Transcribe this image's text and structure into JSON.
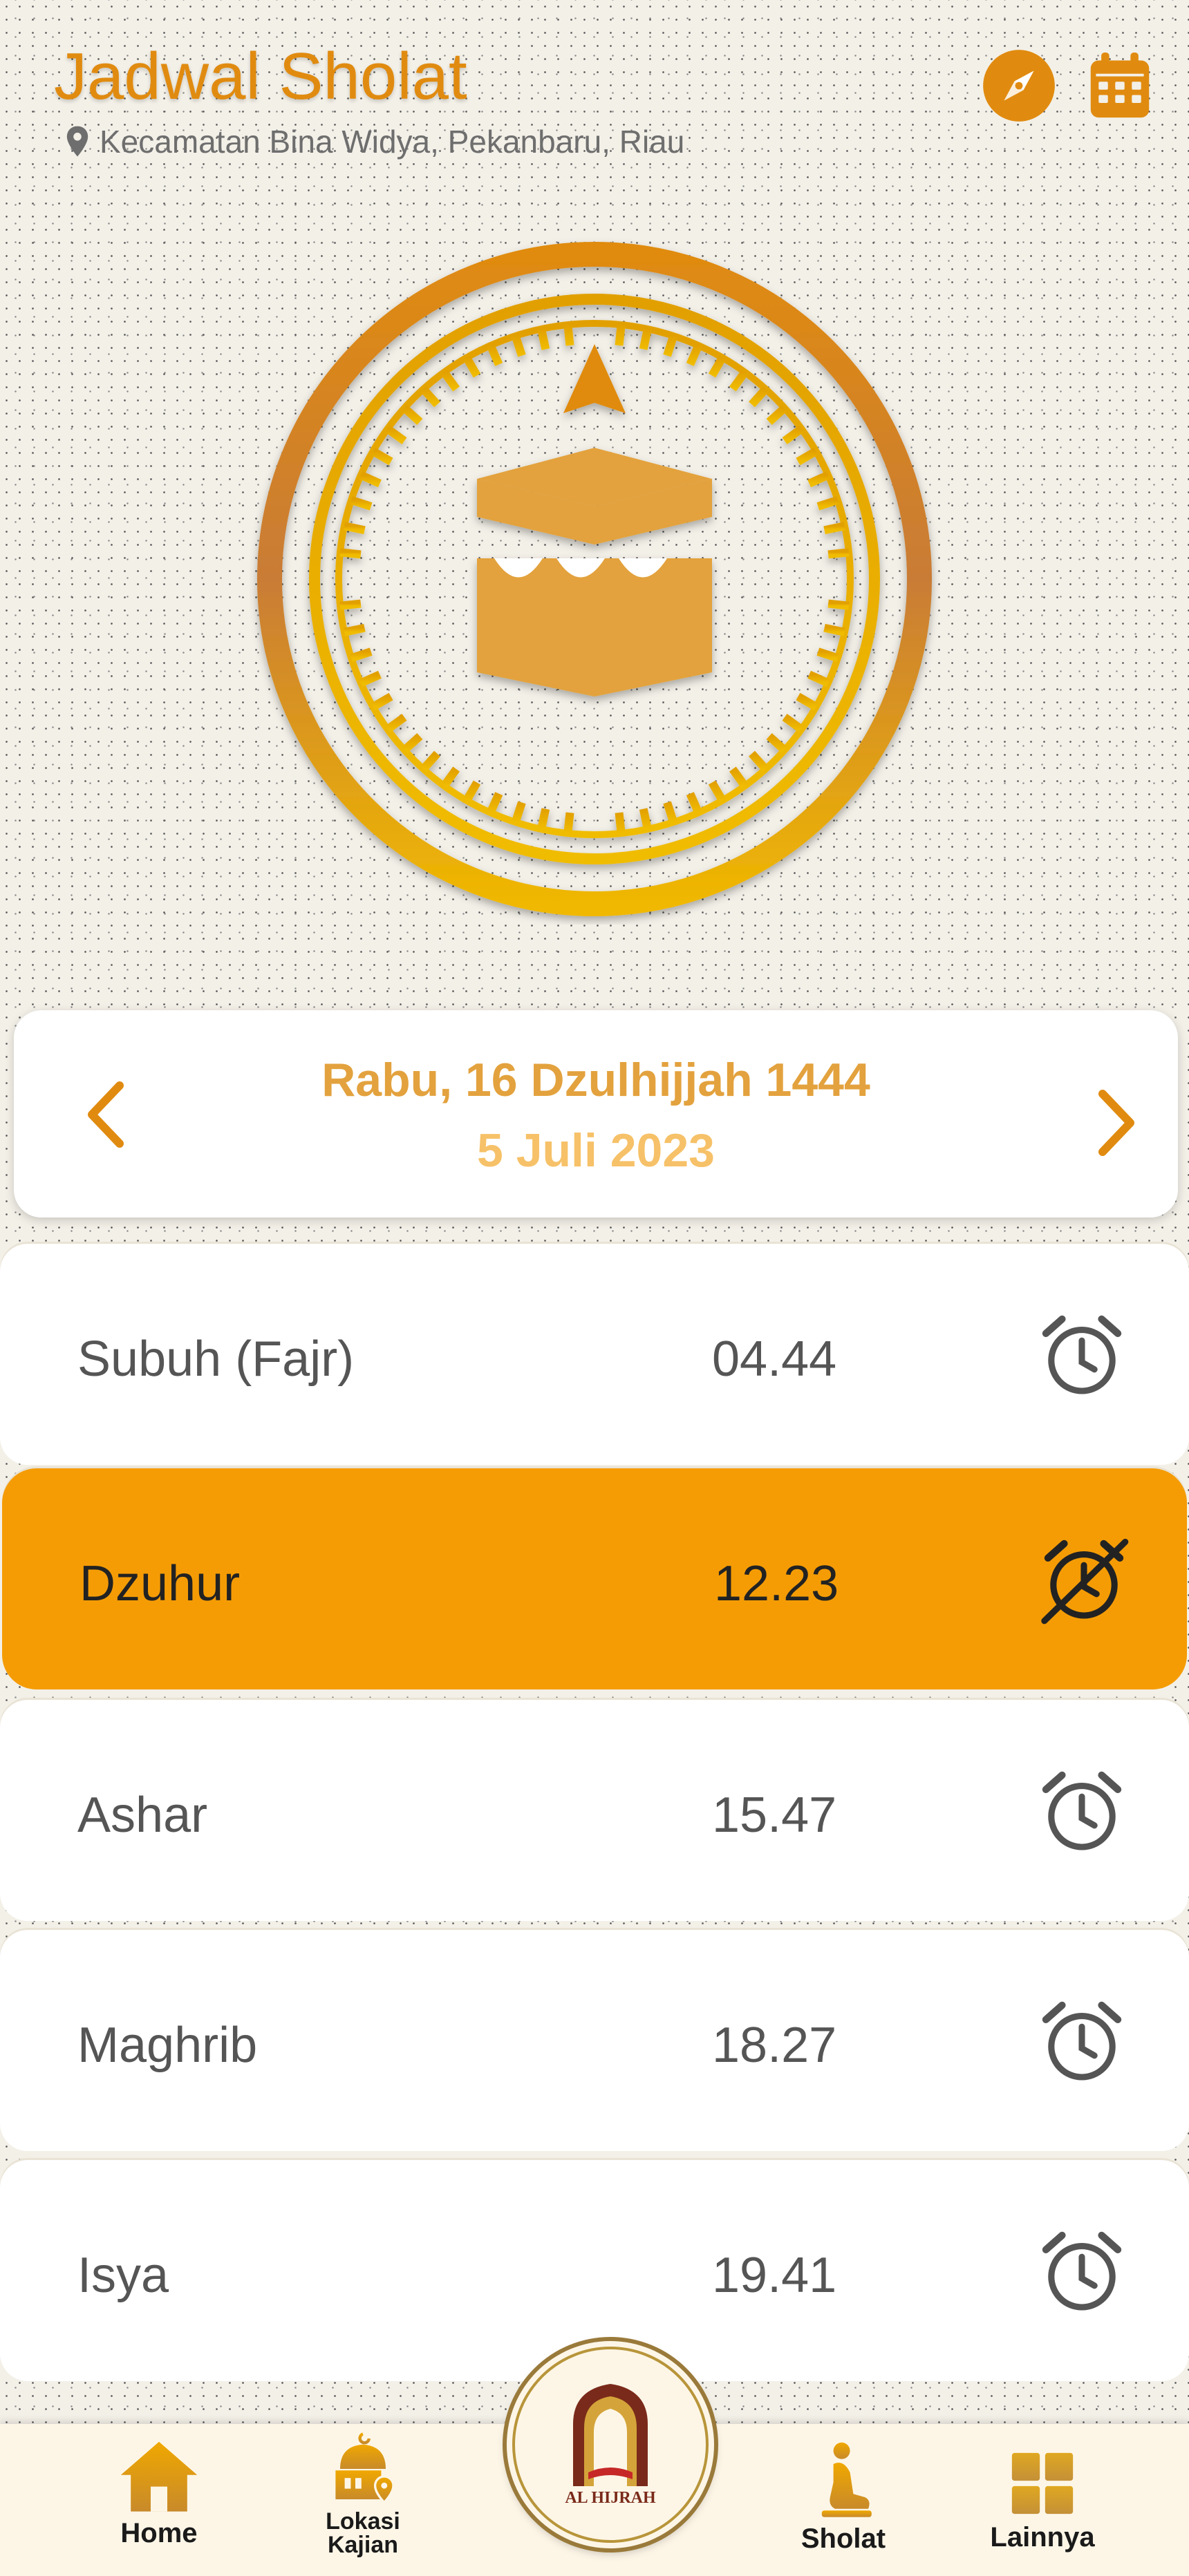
{
  "header": {
    "title": "Jadwal Sholat",
    "location": "Kecamatan Bina Widya, Pekanbaru, Riau",
    "icons": [
      "compass-icon",
      "calendar-icon"
    ]
  },
  "date": {
    "hijri": "Rabu, 16 Dzulhijjah 1444",
    "gregorian": "5 Juli 2023"
  },
  "prayers": [
    {
      "name": "Subuh (Fajr)",
      "time": "04.44",
      "alarm": "alarm-on",
      "active": false
    },
    {
      "name": "Dzuhur",
      "time": "12.23",
      "alarm": "alarm-off",
      "active": true
    },
    {
      "name": "Ashar",
      "time": "15.47",
      "alarm": "alarm-on",
      "active": false
    },
    {
      "name": "Maghrib",
      "time": "18.27",
      "alarm": "alarm-on",
      "active": false
    },
    {
      "name": "Isya",
      "time": "19.41",
      "alarm": "alarm-on",
      "active": false
    }
  ],
  "nav": {
    "home": "Home",
    "lokasi": "Lokasi Kajian",
    "sholat": "Sholat",
    "lainnya": "Lainnya",
    "logo_text": "AL HIJRAH"
  },
  "colors": {
    "accent": "#e08b10",
    "active_row": "#f59c05",
    "hijri_text": "#e3a23e",
    "gregorian_text": "#f6c168"
  }
}
